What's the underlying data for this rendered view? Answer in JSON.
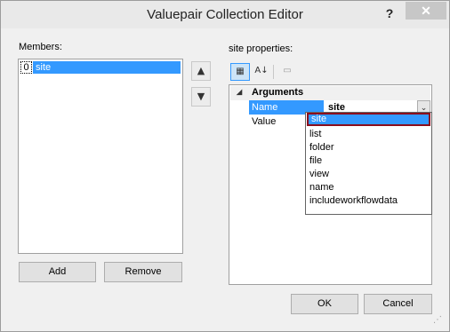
{
  "window": {
    "title": "Valuepair Collection Editor",
    "help_label": "?",
    "close_label": "✕"
  },
  "members": {
    "label": "Members:",
    "items": [
      {
        "index": "0",
        "name": "site"
      }
    ],
    "add_label": "Add",
    "remove_label": "Remove",
    "move_up_icon": "▲",
    "move_down_icon": "▼"
  },
  "properties": {
    "label": "site properties:",
    "toolbar": {
      "categorized_icon": "▦",
      "alphabetical_icon": "A↓",
      "property_pages_icon": "▭"
    },
    "category": {
      "label": "Arguments",
      "toggle": "◢"
    },
    "rows": [
      {
        "name": "Name",
        "value": "site"
      },
      {
        "name": "Value",
        "value": ""
      }
    ],
    "dropdown_arrow": "⌄",
    "dropdown_options": [
      "site",
      "list",
      "folder",
      "file",
      "view",
      "name",
      "includeworkflowdata"
    ],
    "dropdown_selected": "site"
  },
  "footer": {
    "ok_label": "OK",
    "cancel_label": "Cancel"
  },
  "colors": {
    "selection": "#3399ff",
    "focus_border": "#8b0d1c",
    "window_bg": "#f0f0f0"
  }
}
